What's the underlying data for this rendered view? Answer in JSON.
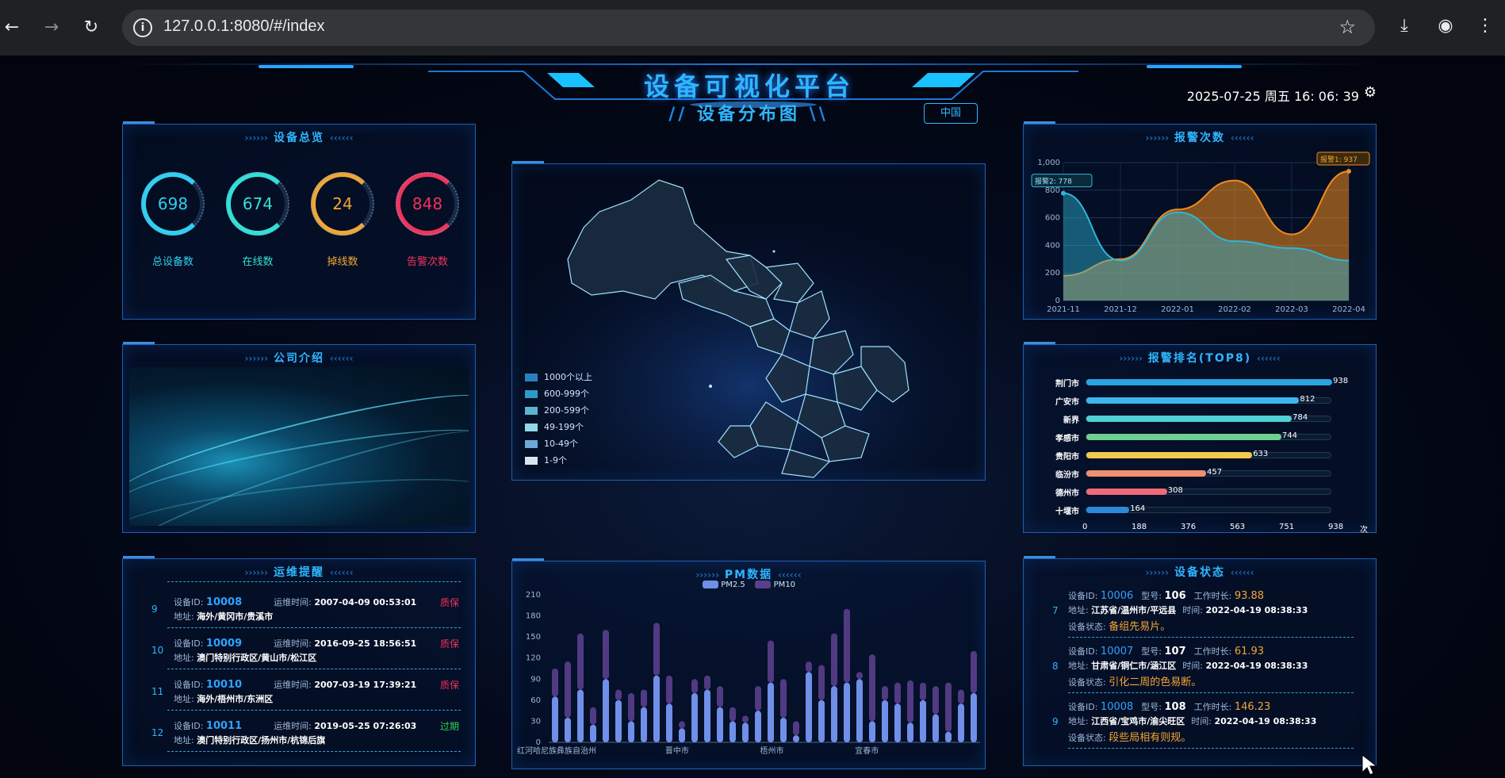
{
  "browser": {
    "url": "127.0.0.1:8080/#/index"
  },
  "header": {
    "title": "设备可视化平台",
    "datetime": "2025-07-25 周五 16: 06: 39"
  },
  "overview": {
    "title": "设备总览",
    "gauges": [
      {
        "value": "698",
        "label": "总设备数",
        "color": "#2fd0f0"
      },
      {
        "value": "674",
        "label": "在线数",
        "color": "#33e0d6"
      },
      {
        "value": "24",
        "label": "掉线数",
        "color": "#f2a634"
      },
      {
        "value": "848",
        "label": "告警次数",
        "color": "#f0335a"
      }
    ]
  },
  "company": {
    "title": "公司介绍"
  },
  "ops": {
    "title": "运维提醒",
    "id_label": "设备ID:",
    "time_label": "运维时间:",
    "addr_label": "地址:",
    "items": [
      {
        "num": "9",
        "id": "10008",
        "time": "2007-04-09 00:53:01",
        "status": "质保",
        "status_color": "#f0335a",
        "address": "海外/黄冈市/贵溪市"
      },
      {
        "num": "10",
        "id": "10009",
        "time": "2016-09-25 18:56:51",
        "status": "质保",
        "status_color": "#f0335a",
        "address": "澳门特别行政区/黄山市/松江区"
      },
      {
        "num": "11",
        "id": "10010",
        "time": "2007-03-19 17:39:21",
        "status": "质保",
        "status_color": "#f0335a",
        "address": "海外/梧州市/东洲区"
      },
      {
        "num": "12",
        "id": "10011",
        "time": "2019-05-25 07:26:03",
        "status": "过期",
        "status_color": "#30d158",
        "address": "澳门特别行政区/扬州市/杭锦后旗"
      }
    ]
  },
  "map": {
    "title": "设备分布图",
    "region_button": "中国",
    "legend": [
      {
        "label": "1000个以上",
        "color": "#2a7fc0"
      },
      {
        "label": "600-999个",
        "color": "#2f9ac8"
      },
      {
        "label": "200-599个",
        "color": "#5bb4d4"
      },
      {
        "label": "49-199个",
        "color": "#8fd8e8"
      },
      {
        "label": "10-49个",
        "color": "#6fa8d8"
      },
      {
        "label": "1-9个",
        "color": "#d8e4ee"
      }
    ]
  },
  "pm": {
    "title": "PM数据",
    "legend": [
      {
        "label": "PM2.5",
        "color": "#6f8fe8"
      },
      {
        "label": "PM10",
        "color": "#5a3f8c"
      }
    ]
  },
  "alarms": {
    "title": "报警次数"
  },
  "ranking": {
    "title": "报警排名(TOP8)",
    "unit": "次",
    "items": [
      {
        "city": "荆门市",
        "value": 938,
        "label": "938",
        "color": "#2aa3e0"
      },
      {
        "city": "广安市",
        "value": 812,
        "label": "812",
        "color": "#3ab8ee"
      },
      {
        "city": "新界",
        "value": 784,
        "label": "784",
        "color": "#4fd0d4"
      },
      {
        "city": "孝感市",
        "value": 744,
        "label": "744",
        "color": "#6fcf8f"
      },
      {
        "city": "贵阳市",
        "value": 633,
        "label": "633",
        "color": "#f2c94c"
      },
      {
        "city": "临汾市",
        "value": 457,
        "label": "457",
        "color": "#f09070"
      },
      {
        "city": "德州市",
        "value": 308,
        "label": "308",
        "color": "#f06a7a"
      },
      {
        "city": "十堰市",
        "value": 164,
        "label": "164",
        "color": "#2a8ad8"
      }
    ],
    "ticks": [
      "0",
      "188",
      "376",
      "563",
      "751",
      "938"
    ]
  },
  "status": {
    "title": "设备状态",
    "id_label": "设备ID:",
    "model_label": "型号:",
    "hours_label": "工作时长:",
    "addr_label": "地址:",
    "time_label": "时间:",
    "state_label": "设备状态:",
    "items": [
      {
        "num": "7",
        "id": "10006",
        "model": "106",
        "hours": "93.88",
        "address": "江苏省/温州市/平远县",
        "time": "2022-04-19 08:38:33",
        "state": "备组先易片。"
      },
      {
        "num": "8",
        "id": "10007",
        "model": "107",
        "hours": "61.93",
        "address": "甘肃省/铜仁市/涵江区",
        "time": "2022-04-19 08:38:33",
        "state": "引化二周的色易断。"
      },
      {
        "num": "9",
        "id": "10008",
        "model": "108",
        "hours": "146.23",
        "address": "江西省/宝鸡市/渝尖旺区",
        "time": "2022-04-19 08:38:33",
        "state": "段些局相有则规。"
      }
    ]
  },
  "chart_data": [
    {
      "type": "area",
      "title": "报警次数",
      "categories": [
        "2021-11",
        "2021-12",
        "2022-01",
        "2022-02",
        "2022-03",
        "2022-04"
      ],
      "ylim": [
        0,
        1000
      ],
      "yticks": [
        "0",
        "200",
        "400",
        "600",
        "800",
        "1,000"
      ],
      "series": [
        {
          "name": "报警1",
          "values": [
            180,
            300,
            660,
            870,
            480,
            937
          ],
          "color": "#f28c1e"
        },
        {
          "name": "报警2",
          "values": [
            778,
            290,
            640,
            430,
            380,
            290
          ],
          "color": "#2fb6d8"
        }
      ],
      "annotations": [
        {
          "text": "报警1: 937"
        },
        {
          "text": "报警2: 778"
        }
      ]
    },
    {
      "type": "bar",
      "title": "PM数据",
      "ylim": [
        0,
        210
      ],
      "yticks": [
        "0",
        "30",
        "60",
        "90",
        "120",
        "150",
        "180",
        "210"
      ],
      "xticks": [
        "红河哈尼族彝族自治州",
        "晋中市",
        "梧州市",
        "宜春市"
      ],
      "series": [
        {
          "name": "PM2.5",
          "values": [
            65,
            35,
            75,
            25,
            90,
            60,
            30,
            50,
            95,
            55,
            20,
            70,
            75,
            50,
            30,
            28,
            45,
            85,
            35,
            10,
            100,
            60,
            80,
            85,
            90,
            30,
            60,
            55,
            28,
            60,
            40,
            15,
            55,
            70
          ],
          "color": "#6f8fe8"
        },
        {
          "name": "PM10",
          "values": [
            40,
            80,
            80,
            25,
            70,
            15,
            40,
            25,
            75,
            40,
            10,
            20,
            20,
            30,
            20,
            10,
            35,
            60,
            55,
            20,
            15,
            50,
            75,
            105,
            10,
            95,
            20,
            30,
            60,
            25,
            40,
            70,
            20,
            60
          ],
          "color": "#5a3f8c"
        }
      ]
    }
  ]
}
